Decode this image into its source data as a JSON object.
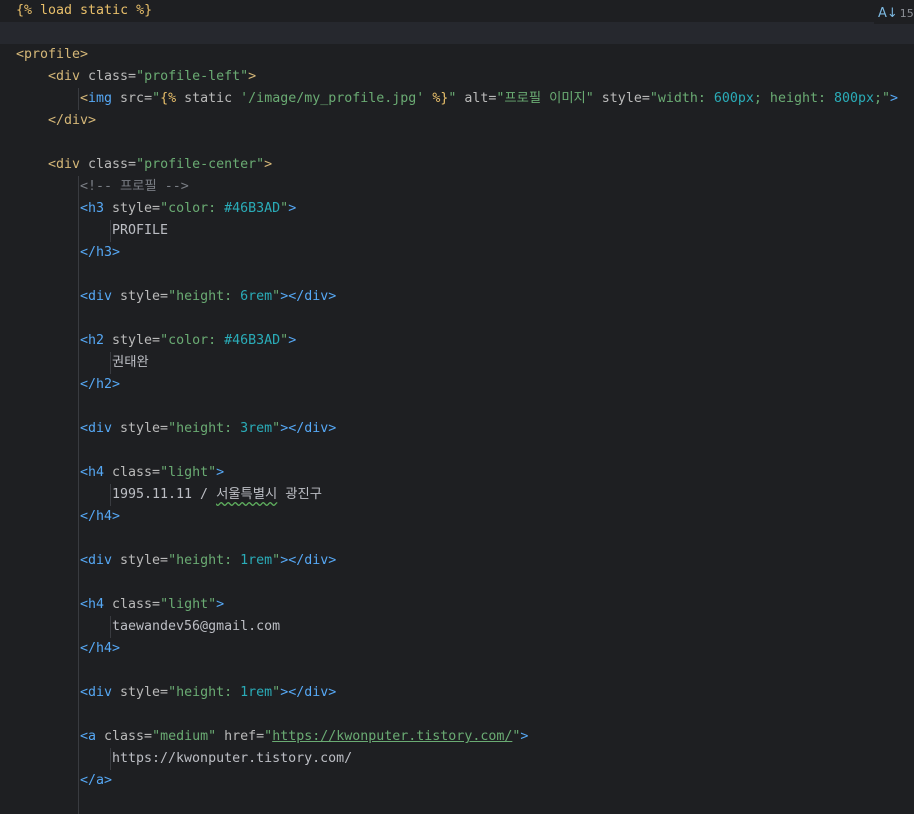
{
  "editor": {
    "inspection_count": "15",
    "inspection_icon": "spellcheck-icon",
    "colors": {
      "background": "#1e1f22",
      "current_line": "#26282e",
      "template_tag": "#e8bf6a",
      "html_tag": "#d5b778",
      "tag_name": "#56a8f5",
      "string": "#6aab73",
      "number": "#2aacb8",
      "comment": "#7a7e85"
    },
    "lines": [
      {
        "indent": 0,
        "tokens": [
          [
            "tpl",
            "{% load static %}"
          ]
        ]
      },
      {
        "indent": 0,
        "current": true,
        "tokens": []
      },
      {
        "indent": 0,
        "tokens": [
          [
            "tag",
            "<profile>"
          ]
        ]
      },
      {
        "indent": 1,
        "tokens": [
          [
            "tag",
            "<div "
          ],
          [
            "attr",
            "class="
          ],
          [
            "str",
            "\"profile-left\""
          ],
          [
            "tag",
            ">"
          ]
        ]
      },
      {
        "indent": 2,
        "tokens": [
          [
            "tag",
            "<"
          ],
          [
            "btag",
            "img "
          ],
          [
            "attr",
            "src="
          ],
          [
            "str",
            "\""
          ],
          [
            "tpl",
            "{% "
          ],
          [
            "attr",
            "static "
          ],
          [
            "str",
            "'/image/my_profile.jpg' "
          ],
          [
            "tpl",
            "%}"
          ],
          [
            "str",
            "\" "
          ],
          [
            "attr",
            "alt="
          ],
          [
            "str",
            "\"프로필 이미지\" "
          ],
          [
            "attr",
            "style="
          ],
          [
            "str",
            "\"width: "
          ],
          [
            "num",
            "600px"
          ],
          [
            "str",
            "; height: "
          ],
          [
            "num",
            "800px"
          ],
          [
            "str",
            ";\""
          ],
          [
            "btag",
            ">"
          ]
        ]
      },
      {
        "indent": 1,
        "tokens": [
          [
            "tag",
            "</div>"
          ]
        ]
      },
      {
        "indent": 0,
        "tokens": []
      },
      {
        "indent": 1,
        "tokens": [
          [
            "tag",
            "<div "
          ],
          [
            "attr",
            "class="
          ],
          [
            "str",
            "\"profile-center\""
          ],
          [
            "tag",
            ">"
          ]
        ]
      },
      {
        "indent": 2,
        "tokens": [
          [
            "cmt",
            "<!-- 프로필 -->"
          ]
        ]
      },
      {
        "indent": 2,
        "tokens": [
          [
            "btag",
            "<h3 "
          ],
          [
            "attr",
            "style="
          ],
          [
            "str",
            "\"color: "
          ],
          [
            "num",
            "#46B3AD"
          ],
          [
            "str",
            "\""
          ],
          [
            "btag",
            ">"
          ]
        ]
      },
      {
        "indent": 3,
        "tokens": [
          [
            "text",
            "PROFILE"
          ]
        ]
      },
      {
        "indent": 2,
        "tokens": [
          [
            "btag",
            "</h3>"
          ]
        ]
      },
      {
        "indent": 2,
        "tokens": []
      },
      {
        "indent": 2,
        "tokens": [
          [
            "btag",
            "<div "
          ],
          [
            "attr",
            "style="
          ],
          [
            "str",
            "\"height: "
          ],
          [
            "num",
            "6rem"
          ],
          [
            "str",
            "\""
          ],
          [
            "btag",
            "></div>"
          ]
        ]
      },
      {
        "indent": 2,
        "tokens": []
      },
      {
        "indent": 2,
        "tokens": [
          [
            "btag",
            "<h2 "
          ],
          [
            "attr",
            "style="
          ],
          [
            "str",
            "\"color: "
          ],
          [
            "num",
            "#46B3AD"
          ],
          [
            "str",
            "\""
          ],
          [
            "btag",
            ">"
          ]
        ]
      },
      {
        "indent": 3,
        "tokens": [
          [
            "text",
            "권태완"
          ]
        ]
      },
      {
        "indent": 2,
        "tokens": [
          [
            "btag",
            "</h2>"
          ]
        ]
      },
      {
        "indent": 2,
        "tokens": []
      },
      {
        "indent": 2,
        "tokens": [
          [
            "btag",
            "<div "
          ],
          [
            "attr",
            "style="
          ],
          [
            "str",
            "\"height: "
          ],
          [
            "num",
            "3rem"
          ],
          [
            "str",
            "\""
          ],
          [
            "btag",
            "></div>"
          ]
        ]
      },
      {
        "indent": 2,
        "tokens": []
      },
      {
        "indent": 2,
        "tokens": [
          [
            "btag",
            "<h4 "
          ],
          [
            "attr",
            "class="
          ],
          [
            "str",
            "\"light\""
          ],
          [
            "btag",
            ">"
          ]
        ]
      },
      {
        "indent": 3,
        "tokens": [
          [
            "text",
            "1995.11.11 / "
          ],
          [
            "typo",
            "서울특별시"
          ],
          [
            "text",
            " 광진구"
          ]
        ]
      },
      {
        "indent": 2,
        "tokens": [
          [
            "btag",
            "</h4>"
          ]
        ]
      },
      {
        "indent": 2,
        "tokens": []
      },
      {
        "indent": 2,
        "tokens": [
          [
            "btag",
            "<div "
          ],
          [
            "attr",
            "style="
          ],
          [
            "str",
            "\"height: "
          ],
          [
            "num",
            "1rem"
          ],
          [
            "str",
            "\""
          ],
          [
            "btag",
            "></div>"
          ]
        ]
      },
      {
        "indent": 2,
        "tokens": []
      },
      {
        "indent": 2,
        "tokens": [
          [
            "btag",
            "<h4 "
          ],
          [
            "attr",
            "class="
          ],
          [
            "str",
            "\"light\""
          ],
          [
            "btag",
            ">"
          ]
        ]
      },
      {
        "indent": 3,
        "tokens": [
          [
            "text",
            "taewandev56@gmail.com"
          ]
        ]
      },
      {
        "indent": 2,
        "tokens": [
          [
            "btag",
            "</h4>"
          ]
        ]
      },
      {
        "indent": 2,
        "tokens": []
      },
      {
        "indent": 2,
        "tokens": [
          [
            "btag",
            "<div "
          ],
          [
            "attr",
            "style="
          ],
          [
            "str",
            "\"height: "
          ],
          [
            "num",
            "1rem"
          ],
          [
            "str",
            "\""
          ],
          [
            "btag",
            "></div>"
          ]
        ]
      },
      {
        "indent": 2,
        "tokens": []
      },
      {
        "indent": 2,
        "tokens": [
          [
            "btag",
            "<a "
          ],
          [
            "attr",
            "class="
          ],
          [
            "str",
            "\"medium\" "
          ],
          [
            "attr",
            "href="
          ],
          [
            "str",
            "\""
          ],
          [
            "link",
            "https://kwonputer.tistory.com/"
          ],
          [
            "str",
            "\""
          ],
          [
            "btag",
            ">"
          ]
        ]
      },
      {
        "indent": 3,
        "tokens": [
          [
            "text",
            "https://kwonputer.tistory.com/"
          ]
        ]
      },
      {
        "indent": 2,
        "tokens": [
          [
            "btag",
            "</a>"
          ]
        ]
      },
      {
        "indent": 2,
        "tokens": []
      }
    ]
  }
}
